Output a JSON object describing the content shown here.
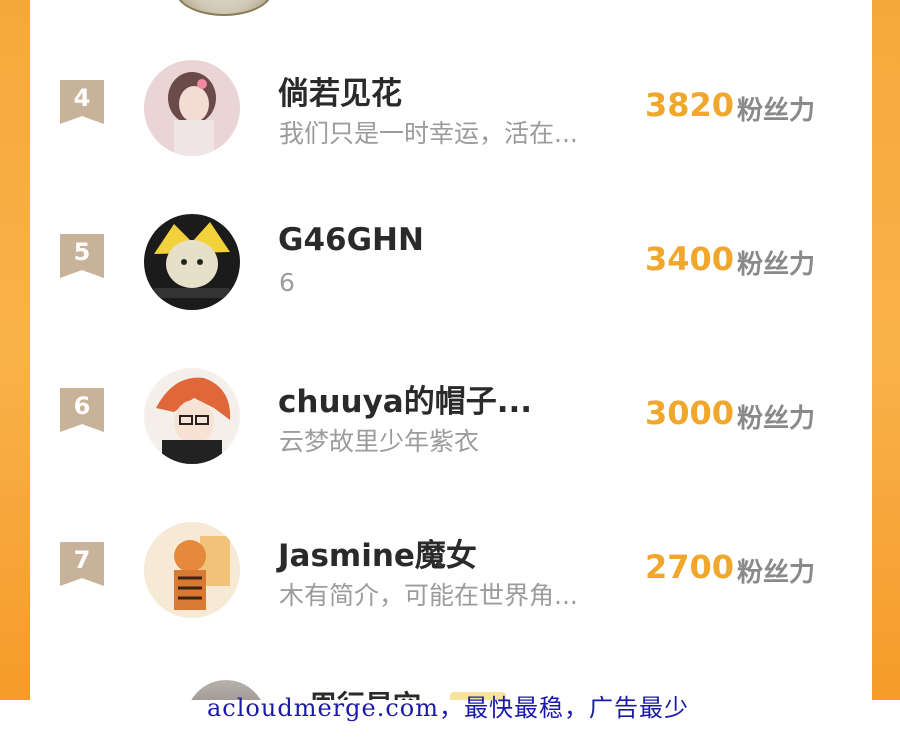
{
  "ranking": {
    "unit_label": "粉丝力",
    "rows": [
      {
        "rank": "4",
        "name": "倘若见花",
        "bio": "我们只是一时幸运，活在...",
        "score": "3820"
      },
      {
        "rank": "5",
        "name": "G46GHN",
        "bio": "6",
        "score": "3400"
      },
      {
        "rank": "6",
        "name": "chuuya的帽子...",
        "bio": "云梦故里少年紫衣",
        "score": "3000"
      },
      {
        "rank": "7",
        "name": "Jasmine魔女",
        "bio": "木有简介，可能在世界角...",
        "score": "2700"
      }
    ],
    "next_row_name_partial": "周行星空"
  },
  "watermark": "acloudmerge.com，最快最稳，广告最少",
  "colors": {
    "accent_orange": "#f0a72b",
    "rank_badge": "#c8b29a",
    "side_gradient": "#f7a83a",
    "watermark_blue": "#1a1aa8"
  }
}
